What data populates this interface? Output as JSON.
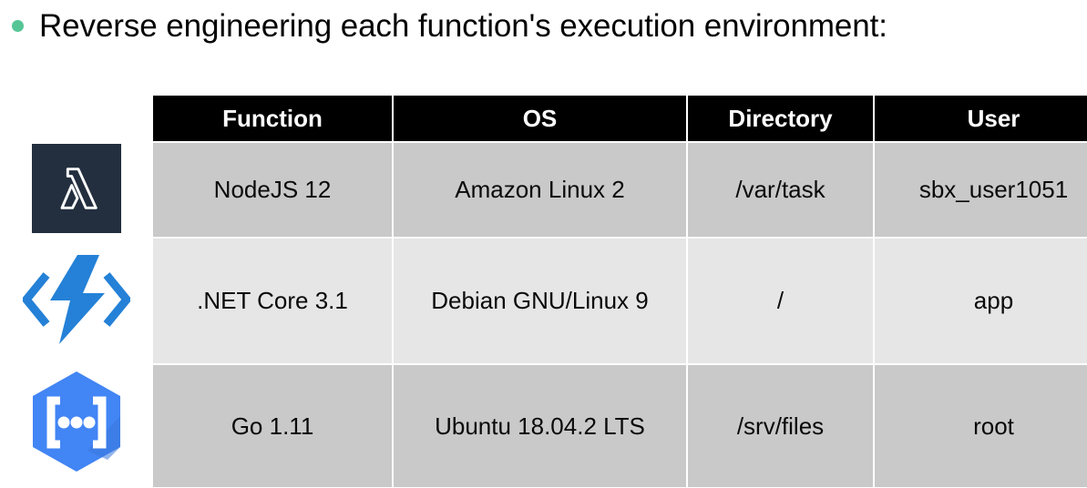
{
  "slide": {
    "bullet_text": "Reverse engineering each function's execution environment:",
    "bullet_color": "#56c596"
  },
  "logos": [
    {
      "name": "aws-lambda-logo",
      "label": "AWS Lambda",
      "glyph": "lambda",
      "background": "#232f3e",
      "foreground": "#ffffff"
    },
    {
      "name": "azure-functions-logo",
      "label": "Azure Functions",
      "glyph": "lightning-bolt-brackets",
      "background": "#ffffff",
      "foreground": "#2481d7"
    },
    {
      "name": "google-cloud-functions-logo",
      "label": "Google Cloud Functions",
      "glyph": "hexagon-brackets-dots",
      "background": "#ffffff",
      "foreground": "#4285f4"
    }
  ],
  "table": {
    "headers": [
      "Function",
      "OS",
      "Directory",
      "User"
    ],
    "header_background": "#000000",
    "header_text_color": "#ffffff",
    "row_band_dark": "#c9c9c9",
    "row_band_light": "#e6e6e6",
    "rows": [
      {
        "function": "NodeJS 12",
        "os": "Amazon Linux 2",
        "directory": "/var/task",
        "user": "sbx_user1051"
      },
      {
        "function": ".NET Core 3.1",
        "os": "Debian GNU/Linux 9",
        "directory": "/",
        "user": "app"
      },
      {
        "function": "Go 1.11",
        "os": "Ubuntu 18.04.2 LTS",
        "directory": "/srv/files",
        "user": "root"
      }
    ]
  }
}
